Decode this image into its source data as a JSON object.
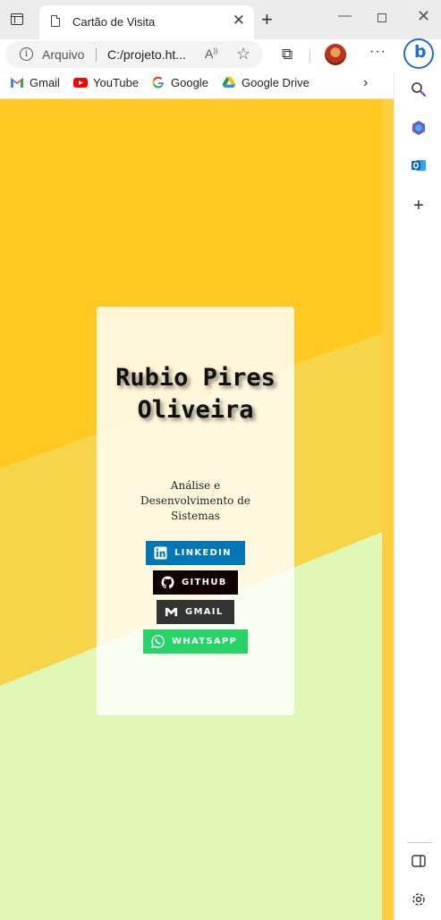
{
  "browser": {
    "tab_title": "Cartão de Visita",
    "address_scheme": "Arquivo",
    "address_url": "C:/projeto.ht...",
    "bookmarks": [
      {
        "label": "Gmail",
        "icon": "gmail-icon"
      },
      {
        "label": "YouTube",
        "icon": "youtube-icon"
      },
      {
        "label": "Google",
        "icon": "google-icon"
      },
      {
        "label": "Google Drive",
        "icon": "google-drive-icon"
      }
    ],
    "sidebar_icons": [
      "search-icon",
      "copilot-icon",
      "outlook-icon",
      "add-icon",
      "split-screen-icon",
      "settings-icon"
    ]
  },
  "card": {
    "name": "Rubio Pires Oliveira",
    "role": "Análise e Desenvolvimento de Sistemas",
    "buttons": [
      {
        "label": "LINKEDIN",
        "icon": "linkedin-icon",
        "color": "#0077b5"
      },
      {
        "label": "GITHUB",
        "icon": "github-icon",
        "color": "#100000"
      },
      {
        "label": "GMAIL",
        "icon": "gmail-m-icon",
        "color": "#333333"
      },
      {
        "label": "WHATSAPP",
        "icon": "whatsapp-icon",
        "color": "#25d366"
      }
    ]
  },
  "colors": {
    "bg_yellow": "#ffc922",
    "bg_yellow_light": "#f7d54a",
    "bg_green": "#e0f7b5"
  }
}
